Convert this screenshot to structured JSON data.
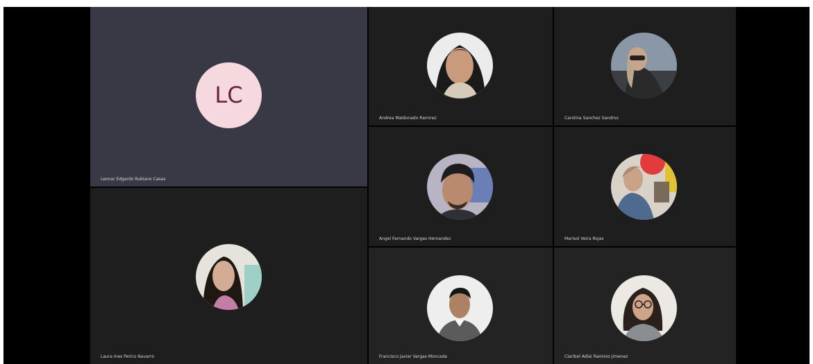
{
  "meeting": {
    "featured": {
      "initials": "LC",
      "name": "Leonar Edgardo Rubiano Casas",
      "tile_color": "#393946",
      "avatar_color": "#f6d8df",
      "initials_color": "#6b2440"
    },
    "participants": [
      {
        "name": "Andrea Maldonado Ramirez"
      },
      {
        "name": "Carolina Sanchez Sandino"
      },
      {
        "name": "Angel Fernando Vargas Hernandez"
      },
      {
        "name": "Marisol Veira Rojas"
      },
      {
        "name": "Laura Ines Perico Navarro"
      },
      {
        "name": "Francisco Javier Vargas Moncada"
      },
      {
        "name": "Claribel Adlai Ramirez Jimenez"
      }
    ]
  },
  "colors": {
    "stage_background": "#000000",
    "tile_background": "#1e1e1e",
    "tile_background_alt": "#232323"
  }
}
